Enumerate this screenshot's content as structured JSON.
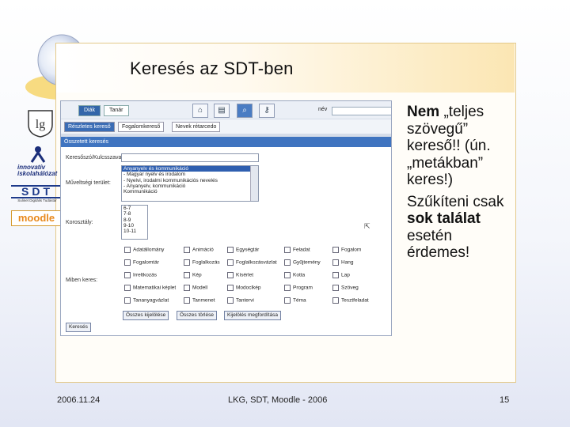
{
  "slide": {
    "title": "Keresés az SDT-ben",
    "footer_date": "2006.11.24",
    "footer_center": "LKG, SDT, Moodle - 2006",
    "page_number": "15"
  },
  "bullet1": {
    "bold": "Nem",
    "rest1": " „teljes szövegű” kereső!! (ún. „metákban” keres!)"
  },
  "bullet2": {
    "part1": "Szűkíteni csak ",
    "bold1": "sok",
    "bold2": "találat",
    "part2": " esetén érdemes!"
  },
  "logos": {
    "innovativ": "innovatív iskolahálózat",
    "sdt": "SDT",
    "sdt_sub": "Sulinet Digitális Tudástár",
    "moodle": "moodle"
  },
  "screenshot": {
    "tab_diak": "Diák",
    "tab_tanar": "Tanár",
    "search_label": "név",
    "subtab1": "Részletes kereső",
    "subtab2": "Fogalomkereső",
    "subtab3": "Nevek rétarcedo",
    "section_header": "Összetett keresés",
    "label_keyword": "Keresőszó/Kulcsszavak:",
    "label_field": "Műveltségi terület:",
    "label_grade": "Korosztály:",
    "label_search_in": "Miben keres:",
    "areas": [
      "Anyanyelv és kommunikáció",
      "- Magyar nyelv és irodalom",
      "- Nyelvi, irodalmi kommunikációs nevelés",
      "- Anyanyelv, kommunikáció",
      "Kommunikáció"
    ],
    "grades": [
      "6-7",
      "7-8",
      "8-9",
      "9-10",
      "10-11"
    ],
    "checkboxes": [
      [
        "Adatállomány",
        "Animáció",
        "Egységtár",
        "Feladat",
        "Fogalom"
      ],
      [
        "Fogalomtár",
        "Foglalkozás",
        "Foglalkozásvázlat",
        "Gyűjtemény",
        "Hang"
      ],
      [
        "Irreltkozás",
        "Kép",
        "Kísérlet",
        "Kotta",
        "Lap"
      ],
      [
        "Matematikai képlet",
        "Modell",
        "Modoclkép",
        "Program",
        "Szöveg"
      ],
      [
        "Tananyagvázlat",
        "Tanmenet",
        "Tantervi",
        "Téma",
        "Tesztfeladat"
      ]
    ],
    "btn_select_all": "Összes kijelölése",
    "btn_clear_all": "Összes törlése",
    "btn_invert": "Kijelölés megfordítása",
    "btn_search": "Keresés"
  }
}
